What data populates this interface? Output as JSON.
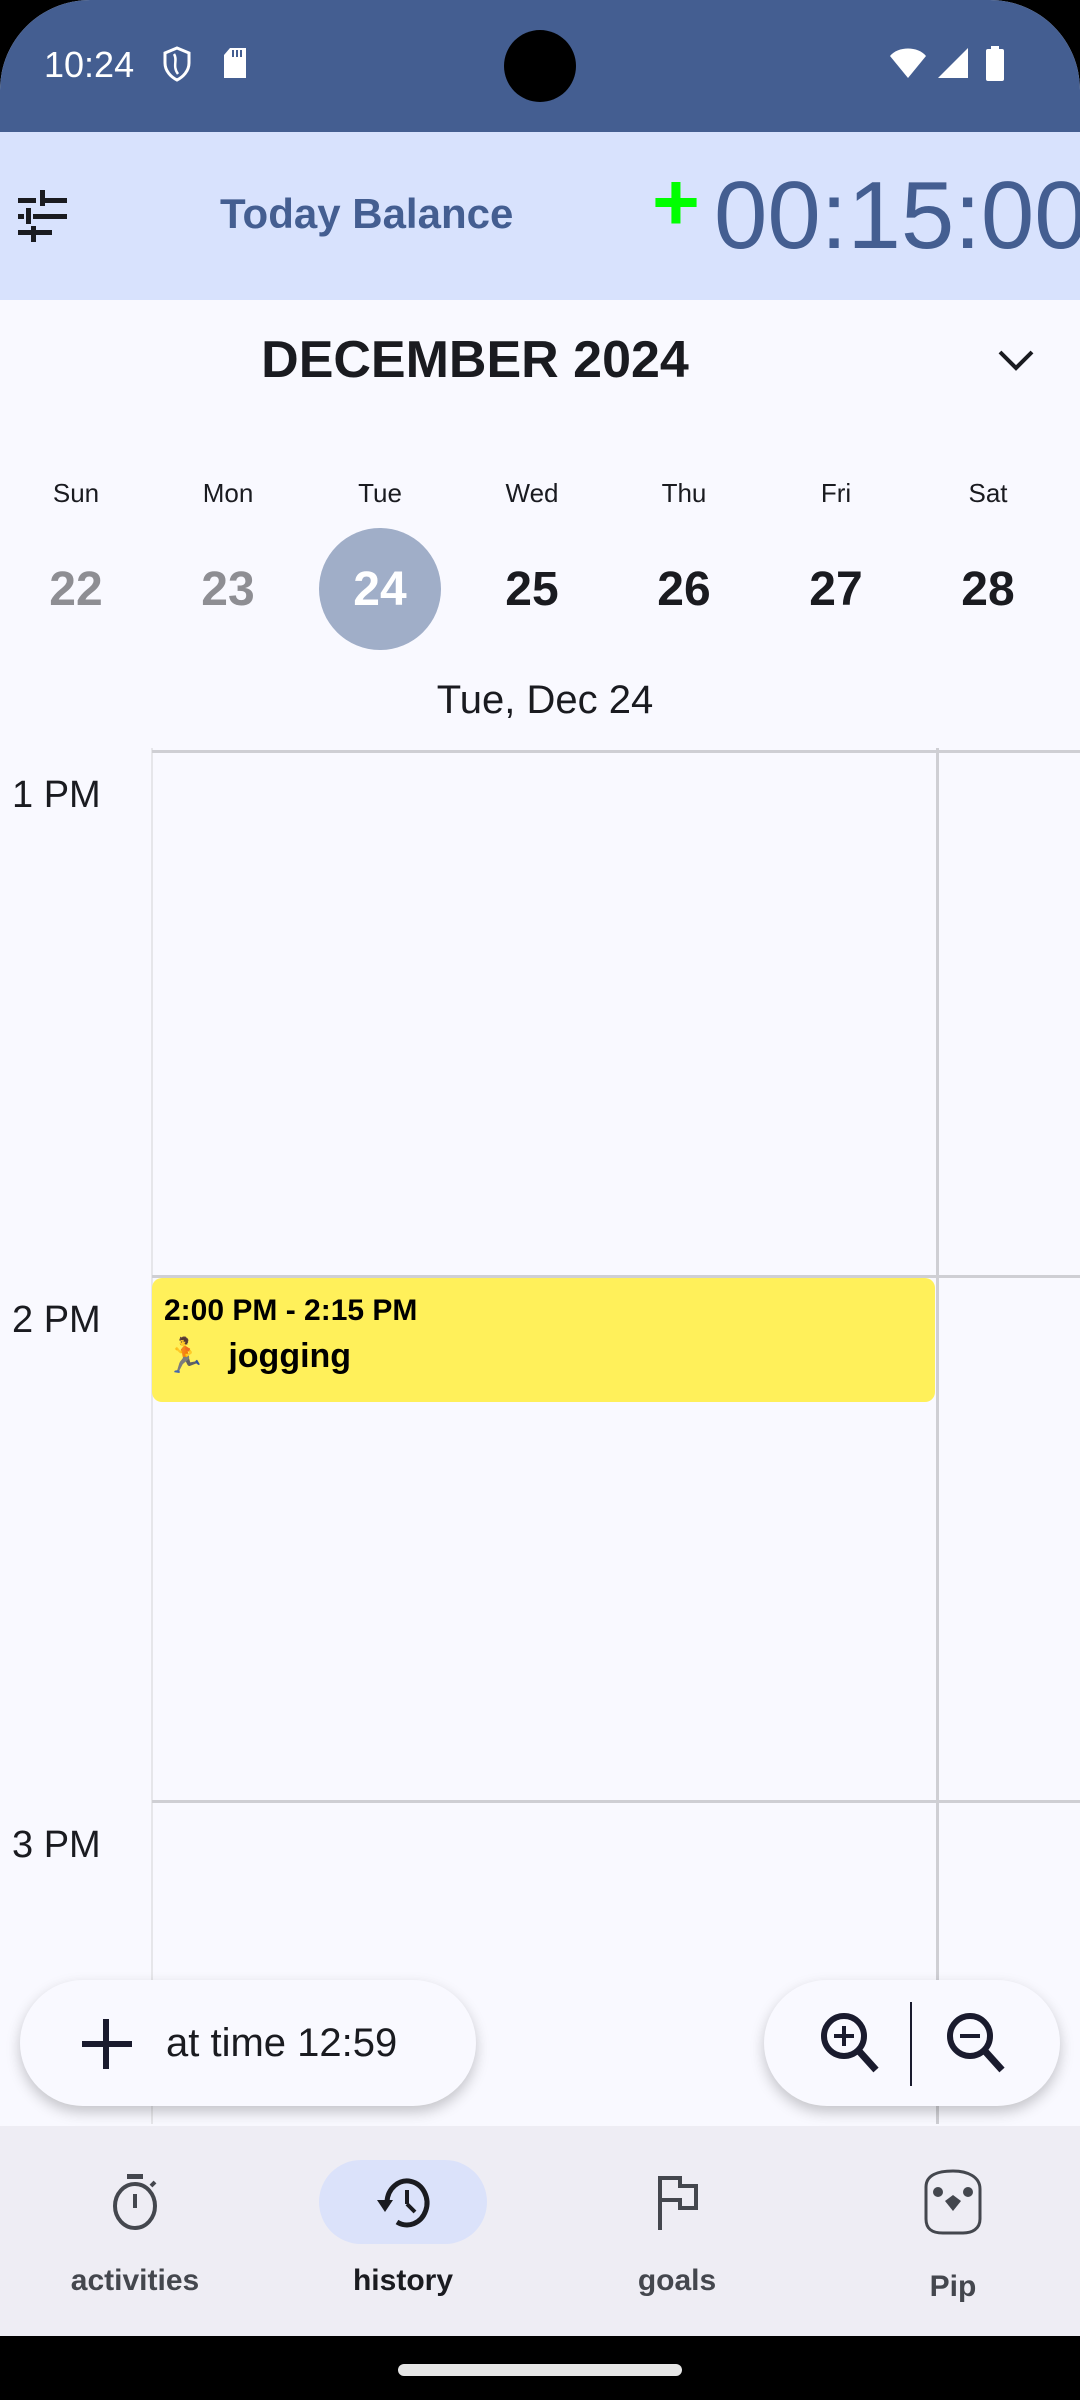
{
  "status_bar": {
    "time": "10:24",
    "left_icons": [
      "shield-icon",
      "sd-card-icon"
    ],
    "right_icons": [
      "wifi-icon",
      "signal-icon",
      "battery-icon"
    ]
  },
  "header": {
    "filter_icon": "tune-icon",
    "balance_label": "Today Balance",
    "balance_sign": "+",
    "balance_value": "00:15:00",
    "colors": {
      "bar_bg": "#d8e2fd",
      "accent": "#445e91",
      "positive": "#00ff00"
    }
  },
  "calendar": {
    "month_title": "DECEMBER 2024",
    "toggle_icon": "chevron-down-icon",
    "weekdays": [
      "Sun",
      "Mon",
      "Tue",
      "Wed",
      "Thu",
      "Fri",
      "Sat"
    ],
    "days": [
      {
        "num": "22",
        "state": "past"
      },
      {
        "num": "23",
        "state": "past"
      },
      {
        "num": "24",
        "state": "selected"
      },
      {
        "num": "25",
        "state": "future"
      },
      {
        "num": "26",
        "state": "future"
      },
      {
        "num": "27",
        "state": "future"
      },
      {
        "num": "28",
        "state": "future"
      }
    ],
    "selected_date_label": "Tue, Dec 24"
  },
  "timeline": {
    "hours": [
      "1 PM",
      "2 PM",
      "3 PM"
    ],
    "events": [
      {
        "time_range": "2:00 PM - 2:15 PM",
        "emoji": "🏃",
        "name": "jogging",
        "color": "#fff05a"
      }
    ]
  },
  "actions": {
    "add_label": "at time 12:59",
    "add_icon": "plus-icon",
    "zoom_in_icon": "zoom-in-icon",
    "zoom_out_icon": "zoom-out-icon"
  },
  "nav": {
    "items": [
      {
        "label": "activities",
        "icon": "stopwatch-icon",
        "active": false
      },
      {
        "label": "history",
        "icon": "history-icon",
        "active": true
      },
      {
        "label": "goals",
        "icon": "flag-icon",
        "active": false
      },
      {
        "label": "Pip",
        "icon": "pip-bird-icon",
        "active": false
      }
    ]
  }
}
